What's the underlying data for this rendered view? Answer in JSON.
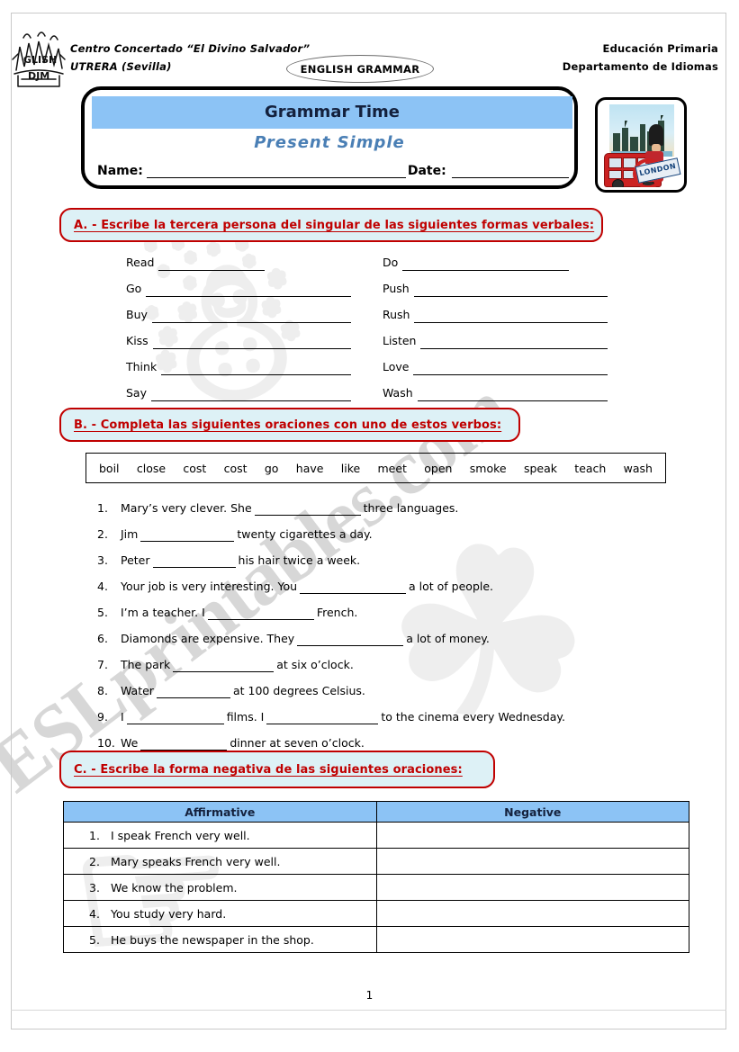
{
  "header": {
    "school_name": "Centro Concertado “El Divino Salvador”",
    "school_city": "UTRERA (Sevilla)",
    "subject_badge": "ENGLISH GRAMMAR",
    "level": "Educación Primaria",
    "department": "Departamento de Idiomas",
    "logo_alt": "english-djm-sketch-logo"
  },
  "title_card": {
    "banner": "Grammar Time",
    "subtitle": "Present Simple",
    "name_label": "Name:",
    "date_label": "Date:",
    "name_value": "",
    "date_value": ""
  },
  "picture": {
    "alt": "london-bus-guard-clipart",
    "sign_text": "LONDON"
  },
  "exercise_a": {
    "instruction": "A. - Escribe la tercera persona del singular de las siguientes formas verbales:",
    "left_verbs": [
      "Read",
      "Go",
      "Buy",
      "Kiss",
      "Think",
      "Say"
    ],
    "right_verbs": [
      "Do",
      "Push",
      "Rush",
      "Listen",
      "Love",
      "Wash"
    ],
    "answers": [
      "",
      "",
      "",
      "",
      "",
      ""
    ]
  },
  "exercise_b": {
    "instruction": "B. - Completa las siguientes oraciones con uno de estos verbos:",
    "word_bank": [
      "boil",
      "close",
      "cost",
      "cost",
      "go",
      "have",
      "like",
      "meet",
      "open",
      "smoke",
      "speak",
      "teach",
      "wash"
    ],
    "sentences": [
      {
        "num": "1.",
        "parts": [
          "Mary’s very clever. She",
          "three languages."
        ],
        "blank_widths": [
          118
        ]
      },
      {
        "num": "2.",
        "parts": [
          "Jim",
          "twenty cigarettes a day."
        ],
        "blank_widths": [
          104
        ]
      },
      {
        "num": "3.",
        "parts": [
          "Peter",
          "his hair twice a week."
        ],
        "blank_widths": [
          92
        ]
      },
      {
        "num": "4.",
        "parts": [
          "Your job is very interesting. You",
          "a lot of people."
        ],
        "blank_widths": [
          118
        ]
      },
      {
        "num": "5.",
        "parts": [
          "I’m a teacher. I",
          "French."
        ],
        "blank_widths": [
          118
        ]
      },
      {
        "num": "6.",
        "parts": [
          "Diamonds are expensive. They",
          "a lot of money."
        ],
        "blank_widths": [
          118
        ]
      },
      {
        "num": "7.",
        "parts": [
          "The park",
          "at six o’clock."
        ],
        "blank_widths": [
          112
        ]
      },
      {
        "num": "8.",
        "parts": [
          "Water",
          "at 100 degrees Celsius."
        ],
        "blank_widths": [
          82
        ]
      },
      {
        "num": "9.",
        "parts": [
          "I",
          "films. I",
          "to the cinema every Wednesday."
        ],
        "blank_widths": [
          108,
          124
        ]
      },
      {
        "num": "10.",
        "parts": [
          "We",
          "dinner at seven o’clock."
        ],
        "blank_widths": [
          96
        ]
      }
    ]
  },
  "exercise_c": {
    "instruction": "C. - Escribe la forma negativa de las siguientes oraciones:",
    "columns": [
      "Affirmative",
      "Negative"
    ],
    "rows": [
      {
        "num": "1.",
        "affirmative": "I speak French very well.",
        "negative": ""
      },
      {
        "num": "2.",
        "affirmative": "Mary speaks French very well.",
        "negative": ""
      },
      {
        "num": "3.",
        "affirmative": "We know the problem.",
        "negative": ""
      },
      {
        "num": "4.",
        "affirmative": "You study very hard.",
        "negative": ""
      },
      {
        "num": "5.",
        "affirmative": "He buys the newspaper in the shop.",
        "negative": ""
      }
    ]
  },
  "watermark": {
    "text": "ESLprintables.com"
  },
  "footer": {
    "page_number": "1"
  },
  "colors": {
    "banner_blue": "#8cc3f5",
    "instruction_red": "#c00000",
    "instruction_fill": "#ddf1f6",
    "subtitle_blue": "#4a7fb5",
    "watermark_gray": "#c9c9c9"
  }
}
